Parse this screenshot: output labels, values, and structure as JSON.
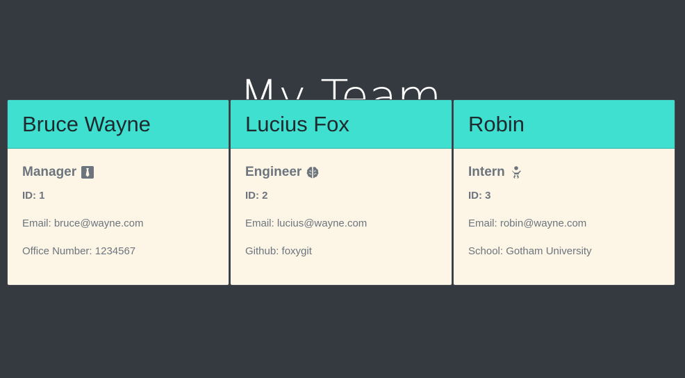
{
  "page": {
    "title": "My Team",
    "background": "#343a40",
    "accent": "#40e0d0",
    "card_background": "#fdf5e6"
  },
  "team": [
    {
      "name": "Bruce Wayne",
      "role": "Manager",
      "role_icon": "tie-icon",
      "id": "ID: 1",
      "email": "Email: bruce@wayne.com",
      "extra": "Office Number: 1234567"
    },
    {
      "name": "Lucius Fox",
      "role": "Engineer",
      "role_icon": "brain-icon",
      "id": "ID: 2",
      "email": "Email: lucius@wayne.com",
      "extra": "Github: foxygit"
    },
    {
      "name": "Robin",
      "role": "Intern",
      "role_icon": "baby-icon",
      "id": "ID: 3",
      "email": "Email: robin@wayne.com",
      "extra": "School: Gotham University"
    }
  ]
}
